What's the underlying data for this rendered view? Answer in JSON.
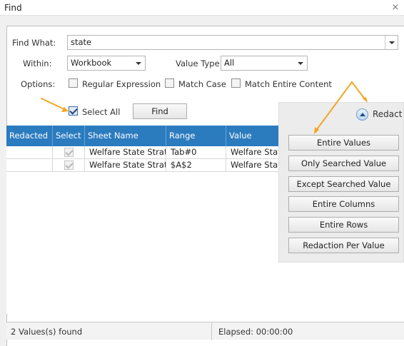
{
  "window": {
    "title": "Find",
    "close_glyph": "×"
  },
  "find_what": {
    "label": "Find What:",
    "value": "state"
  },
  "within": {
    "label": "Within:",
    "selected": "Workbook"
  },
  "value_type": {
    "label": "Value Type:",
    "selected": "All"
  },
  "options": {
    "label": "Options:",
    "regular_expression": {
      "label": "Regular Expression",
      "checked": false
    },
    "match_case": {
      "label": "Match Case",
      "checked": false
    },
    "match_entire_content": {
      "label": "Match Entire Content",
      "checked": false
    }
  },
  "select_all": {
    "label": "Select All",
    "checked": true
  },
  "find_button": "Find",
  "grid": {
    "columns": [
      "Redacted",
      "Select",
      "Sheet Name",
      "Range",
      "Value"
    ],
    "rows": [
      {
        "redacted": "",
        "select": true,
        "sheet_name": "Welfare State Strategy",
        "range": "Tab#0",
        "value": "Welfare State Strategy"
      },
      {
        "redacted": "",
        "select": true,
        "sheet_name": "Welfare State Strategy",
        "range": "$A$2",
        "value": "Welfare State Strategy"
      }
    ]
  },
  "redact_panel": {
    "toggle_label": "Redact",
    "buttons": [
      "Entire Values",
      "Only Searched Value",
      "Except Searched Value",
      "Entire Columns",
      "Entire Rows",
      "Redaction Per Value"
    ]
  },
  "status": {
    "found": "2 Values(s) found",
    "elapsed": "Elapsed: 00:00:00"
  },
  "colors": {
    "grid_header": "#2b7bbf",
    "annotation_arrow": "#f5a623"
  },
  "icons": [
    "close-icon",
    "dropdown-arrow-icon",
    "checkbox-icon",
    "collapse-up-icon",
    "annotation-arrow-icon"
  ]
}
